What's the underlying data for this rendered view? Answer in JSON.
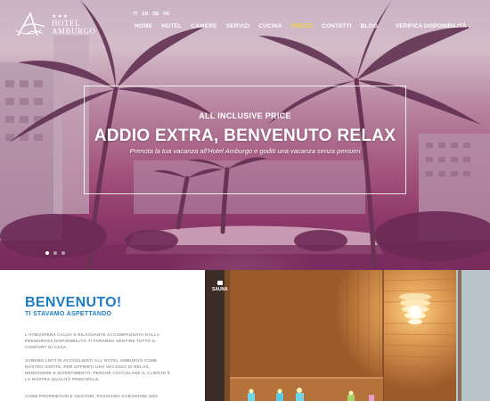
{
  "header": {
    "logo": {
      "stars": "★★★",
      "name_line1": "HOTEL",
      "name_line2": "AMBURGO"
    },
    "languages": [
      "IT",
      "EN",
      "DE",
      "FR"
    ],
    "nav": [
      {
        "label": "HOME",
        "active": false
      },
      {
        "label": "HOTEL",
        "active": false
      },
      {
        "label": "CAMERE",
        "active": false
      },
      {
        "label": "SERVIZI",
        "active": false
      },
      {
        "label": "CUCINA",
        "active": false
      },
      {
        "label": "PREZZI",
        "active": true
      },
      {
        "label": "CONTATTI",
        "active": false
      },
      {
        "label": "BLOG",
        "active": false
      }
    ],
    "cta": {
      "label": "VERIFICA DISPONIBILITÀ",
      "icon": "chevron-down-icon"
    },
    "active_color": "#f5d53a"
  },
  "hero": {
    "kicker": "ALL INCLUSIVE PRICE",
    "title": "ADDIO EXTRA, BENVENUTO RELAX",
    "subtitle": "Prenota la tua vacanza all'Hotel Amburgo e goditi una vacanza senza pensieri",
    "slides": {
      "count": 3,
      "active": 1
    }
  },
  "welcome": {
    "title": "BENVENUTO!",
    "subtitle": "TI STAVAMO ASPETTANDO",
    "paragraphs": [
      "L'ATMOSFERA CALDA E RILASSANTE ACCOMPAGNATA DALLA PREMUROSA DISPONIBILITÀ TI FARANNO SENTIRE TUTTO IL COMFORT DI CASA.",
      "SAREMO LIETI DI ACCOGLIERTI ALL'HOTEL AMBURGO COME NOSTRO OSPITE, PER OFFRIRTI UNA VACANZA DI RELAX, BENESSERE E DIVERTIMENTO; PERCHÉ COCCOLARE IL CLIENTE È LA NOSTRA QUALITÀ PRINCIPALE.",
      "COME PROPRIETARI E GESTORI, POSSIAMO GARANTIRE UNA"
    ],
    "accent": "#1e7cc4"
  },
  "gallery": {
    "label": "SAUNA",
    "icon": "camera-icon"
  }
}
